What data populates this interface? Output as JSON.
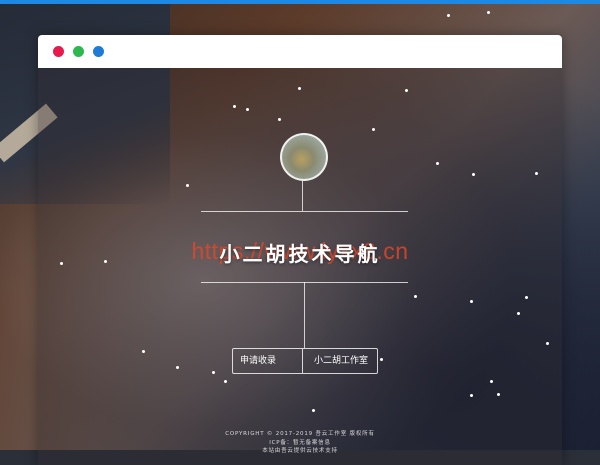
{
  "browser": {
    "controls": [
      "close-dot",
      "minimize-dot",
      "maximize-dot"
    ],
    "colors": {
      "close": "#e8194d",
      "minimize": "#2db84d",
      "maximize": "#1e7bd6",
      "accent": "#1e88e5"
    }
  },
  "hero": {
    "avatar": "avatar-photo",
    "title": "小二胡技术导航",
    "watermark": "https://www.lyxx8.cn"
  },
  "actions": {
    "apply_label": "申请收录",
    "studio_label": "小二胡工作室"
  },
  "footer": {
    "copyright": "COPYRIGHT © 2017-2019 吾云工作室 版权所有",
    "icp": "ICP备：暂无备案信息",
    "support": "本站由吾云提供云技术支持"
  }
}
